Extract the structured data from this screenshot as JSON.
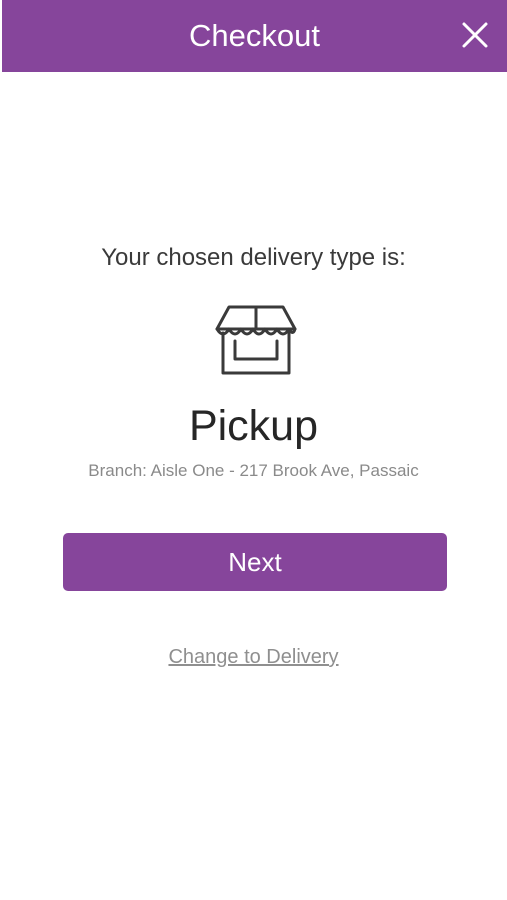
{
  "header": {
    "title": "Checkout",
    "close_icon": "close-icon",
    "background_color": "#86459b"
  },
  "main": {
    "prompt": "Your chosen delivery type is:",
    "icon": "store-icon",
    "delivery_type": "Pickup",
    "branch": "Branch: Aisle One - 217 Brook Ave, Passaic",
    "next_label": "Next",
    "change_label": "Change to Delivery"
  },
  "colors": {
    "accent": "#86459b",
    "text_dark": "#262626",
    "text_muted": "#8a8a8a"
  }
}
